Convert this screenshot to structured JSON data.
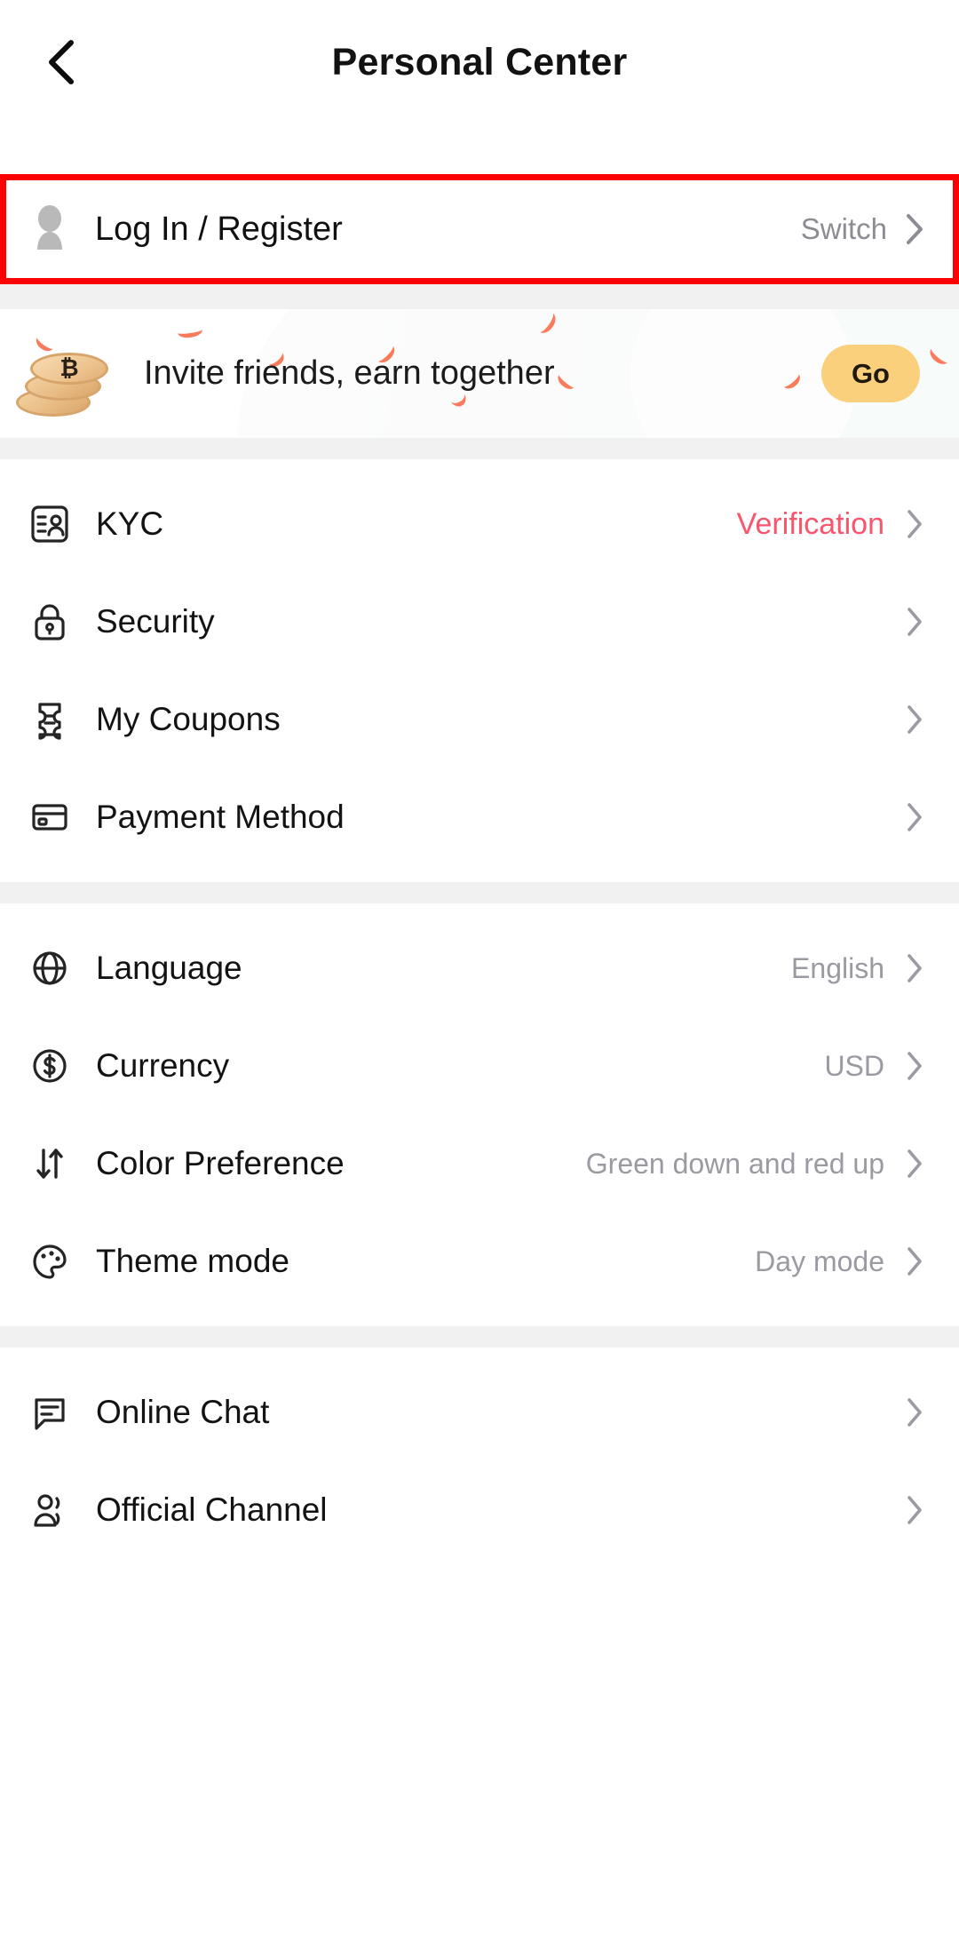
{
  "header": {
    "title": "Personal Center",
    "back_icon": "chevron-left-icon"
  },
  "account": {
    "icon": "person-avatar-icon",
    "label": "Log In / Register",
    "action_label": "Switch",
    "chevron": "chevron-right-icon",
    "highlight_color": "#fe0000"
  },
  "banner": {
    "icon": "bitcoin-coins-icon",
    "coin_symbol": "₿",
    "text": "Invite friends, earn together",
    "button_label": "Go",
    "button_color": "#fbd07c"
  },
  "groups": [
    {
      "rows": [
        {
          "icon": "id-card-icon",
          "label": "KYC",
          "value": "Verification",
          "value_style": "accent"
        },
        {
          "icon": "lock-icon",
          "label": "Security",
          "value": ""
        },
        {
          "icon": "ticket-icon",
          "label": "My Coupons",
          "value": ""
        },
        {
          "icon": "credit-card-icon",
          "label": "Payment Method",
          "value": ""
        }
      ]
    },
    {
      "rows": [
        {
          "icon": "globe-icon",
          "label": "Language",
          "value": "English"
        },
        {
          "icon": "dollar-circle-icon",
          "label": "Currency",
          "value": "USD"
        },
        {
          "icon": "up-down-arrows-icon",
          "label": "Color Preference",
          "value": "Green down and red up"
        },
        {
          "icon": "palette-icon",
          "label": "Theme mode",
          "value": "Day mode"
        }
      ]
    },
    {
      "rows": [
        {
          "icon": "chat-bubble-icon",
          "label": "Online Chat",
          "value": ""
        },
        {
          "icon": "broadcast-person-icon",
          "label": "Official Channel",
          "value": ""
        }
      ]
    }
  ],
  "colors": {
    "accent_red": "#f8566c",
    "highlight_red": "#fe0000",
    "separator_gray": "#f1f1f1",
    "value_gray": "#9a9aa2",
    "button_amber": "#fbd07c"
  }
}
